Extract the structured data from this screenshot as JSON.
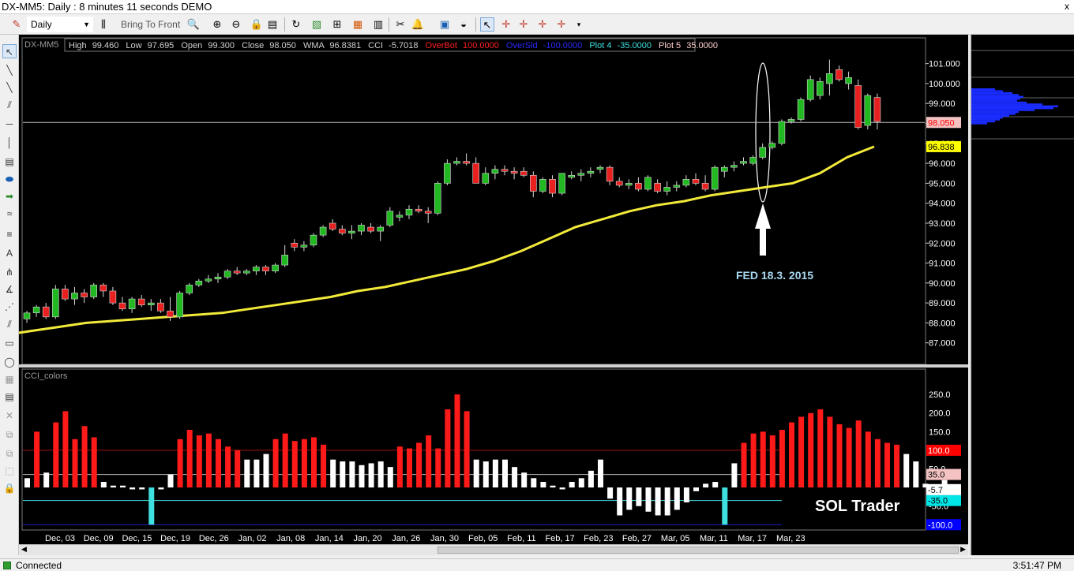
{
  "window": {
    "title": "DX-MM5: Daily : 8 minutes 11 seconds DEMO",
    "close_glyph": "x"
  },
  "toolbar": {
    "period": "Daily",
    "bring_to_front": "Bring To Front"
  },
  "chart_data": [
    {
      "type": "candlestick",
      "symbol": "DX-MM5",
      "info_bar": {
        "high_label": "High",
        "high": "99.460",
        "low_label": "Low",
        "low": "97.695",
        "open_label": "Open",
        "open": "99.300",
        "close_label": "Close",
        "close": "98.050",
        "wma_label": "WMA",
        "wma": "96.8381",
        "cci_label": "CCI",
        "cci": "-5.7018",
        "overbot_label": "OverBot",
        "overbot": "100.0000",
        "oversld_label": "OverSld",
        "oversld": "-100.0000",
        "plot4_label": "Plot 4",
        "plot4": "-35.0000",
        "plot5_label": "Plot 5",
        "plot5": "35.0000"
      },
      "y_ticks": [
        "101.000",
        "100.000",
        "99.000",
        "98.000",
        "97.000",
        "96.000",
        "95.000",
        "94.000",
        "93.000",
        "92.000",
        "91.000",
        "90.000",
        "89.000",
        "88.000",
        "87.000"
      ],
      "ylim": [
        86.0,
        101.5
      ],
      "last_price": "98.050",
      "wma_last": "96.838",
      "annotation": "FED 18.3. 2015",
      "candles": [
        {
          "o": 88.2,
          "h": 88.6,
          "l": 88.0,
          "c": 88.5
        },
        {
          "o": 88.5,
          "h": 88.9,
          "l": 88.3,
          "c": 88.8
        },
        {
          "o": 88.8,
          "h": 89.0,
          "l": 88.2,
          "c": 88.3
        },
        {
          "o": 88.3,
          "h": 89.9,
          "l": 88.2,
          "c": 89.7
        },
        {
          "o": 89.7,
          "h": 89.9,
          "l": 89.1,
          "c": 89.2
        },
        {
          "o": 89.2,
          "h": 89.8,
          "l": 88.9,
          "c": 89.5
        },
        {
          "o": 89.5,
          "h": 89.7,
          "l": 89.0,
          "c": 89.3
        },
        {
          "o": 89.3,
          "h": 90.0,
          "l": 89.2,
          "c": 89.9
        },
        {
          "o": 89.9,
          "h": 90.0,
          "l": 89.3,
          "c": 89.6
        },
        {
          "o": 89.6,
          "h": 89.8,
          "l": 88.9,
          "c": 89.0
        },
        {
          "o": 89.0,
          "h": 89.3,
          "l": 88.6,
          "c": 88.7
        },
        {
          "o": 88.7,
          "h": 89.3,
          "l": 88.5,
          "c": 89.2
        },
        {
          "o": 89.2,
          "h": 89.4,
          "l": 88.8,
          "c": 88.9
        },
        {
          "o": 88.9,
          "h": 89.2,
          "l": 88.6,
          "c": 89.0
        },
        {
          "o": 89.0,
          "h": 89.2,
          "l": 88.5,
          "c": 88.6
        },
        {
          "o": 88.6,
          "h": 89.3,
          "l": 88.1,
          "c": 88.3
        },
        {
          "o": 88.3,
          "h": 89.6,
          "l": 88.2,
          "c": 89.5
        },
        {
          "o": 89.5,
          "h": 90.0,
          "l": 89.4,
          "c": 89.9
        },
        {
          "o": 89.9,
          "h": 90.2,
          "l": 89.8,
          "c": 90.1
        },
        {
          "o": 90.1,
          "h": 90.4,
          "l": 90.0,
          "c": 90.2
        },
        {
          "o": 90.2,
          "h": 90.5,
          "l": 90.0,
          "c": 90.3
        },
        {
          "o": 90.3,
          "h": 90.7,
          "l": 90.2,
          "c": 90.6
        },
        {
          "o": 90.6,
          "h": 90.8,
          "l": 90.4,
          "c": 90.5
        },
        {
          "o": 90.5,
          "h": 90.7,
          "l": 90.4,
          "c": 90.6
        },
        {
          "o": 90.6,
          "h": 90.9,
          "l": 90.4,
          "c": 90.8
        },
        {
          "o": 90.8,
          "h": 90.9,
          "l": 90.4,
          "c": 90.6
        },
        {
          "o": 90.6,
          "h": 91.0,
          "l": 90.5,
          "c": 90.9
        },
        {
          "o": 90.9,
          "h": 91.9,
          "l": 90.8,
          "c": 91.4
        },
        {
          "o": 92.0,
          "h": 92.2,
          "l": 91.6,
          "c": 91.8
        },
        {
          "o": 91.8,
          "h": 92.1,
          "l": 91.6,
          "c": 91.9
        },
        {
          "o": 91.9,
          "h": 92.5,
          "l": 91.8,
          "c": 92.4
        },
        {
          "o": 92.4,
          "h": 92.9,
          "l": 92.3,
          "c": 92.8
        },
        {
          "o": 93.0,
          "h": 93.2,
          "l": 92.6,
          "c": 92.7
        },
        {
          "o": 92.7,
          "h": 92.9,
          "l": 92.4,
          "c": 92.5
        },
        {
          "o": 92.5,
          "h": 92.9,
          "l": 92.2,
          "c": 92.6
        },
        {
          "o": 92.6,
          "h": 93.0,
          "l": 92.4,
          "c": 92.9
        },
        {
          "o": 92.8,
          "h": 93.0,
          "l": 92.5,
          "c": 92.6
        },
        {
          "o": 92.6,
          "h": 92.9,
          "l": 92.1,
          "c": 92.8
        },
        {
          "o": 92.9,
          "h": 93.8,
          "l": 92.8,
          "c": 93.6
        },
        {
          "o": 93.3,
          "h": 93.6,
          "l": 93.1,
          "c": 93.4
        },
        {
          "o": 93.4,
          "h": 93.9,
          "l": 93.2,
          "c": 93.7
        },
        {
          "o": 93.7,
          "h": 93.9,
          "l": 93.5,
          "c": 93.6
        },
        {
          "o": 93.6,
          "h": 93.8,
          "l": 93.0,
          "c": 93.5
        },
        {
          "o": 93.5,
          "h": 95.1,
          "l": 93.4,
          "c": 95.0
        },
        {
          "o": 95.0,
          "h": 96.2,
          "l": 94.9,
          "c": 96.0
        },
        {
          "o": 96.0,
          "h": 96.3,
          "l": 95.9,
          "c": 96.1
        },
        {
          "o": 96.1,
          "h": 96.5,
          "l": 95.9,
          "c": 96.0
        },
        {
          "o": 96.0,
          "h": 96.3,
          "l": 95.0,
          "c": 95.0
        },
        {
          "o": 95.0,
          "h": 95.8,
          "l": 94.9,
          "c": 95.5
        },
        {
          "o": 95.5,
          "h": 95.9,
          "l": 95.2,
          "c": 95.7
        },
        {
          "o": 95.7,
          "h": 95.9,
          "l": 95.4,
          "c": 95.6
        },
        {
          "o": 95.6,
          "h": 95.8,
          "l": 95.2,
          "c": 95.5
        },
        {
          "o": 95.6,
          "h": 95.8,
          "l": 95.3,
          "c": 95.4
        },
        {
          "o": 95.4,
          "h": 95.6,
          "l": 94.3,
          "c": 94.6
        },
        {
          "o": 94.6,
          "h": 95.3,
          "l": 94.5,
          "c": 95.2
        },
        {
          "o": 95.2,
          "h": 95.4,
          "l": 94.3,
          "c": 94.5
        },
        {
          "o": 94.5,
          "h": 95.5,
          "l": 94.4,
          "c": 95.5
        },
        {
          "o": 95.3,
          "h": 95.6,
          "l": 95.2,
          "c": 95.4
        },
        {
          "o": 95.4,
          "h": 95.7,
          "l": 95.1,
          "c": 95.5
        },
        {
          "o": 95.5,
          "h": 95.8,
          "l": 95.3,
          "c": 95.6
        },
        {
          "o": 95.7,
          "h": 95.9,
          "l": 95.5,
          "c": 95.8
        },
        {
          "o": 95.8,
          "h": 95.9,
          "l": 94.9,
          "c": 95.1
        },
        {
          "o": 95.1,
          "h": 95.3,
          "l": 94.8,
          "c": 94.9
        },
        {
          "o": 94.9,
          "h": 95.2,
          "l": 94.7,
          "c": 95.0
        },
        {
          "o": 95.0,
          "h": 95.3,
          "l": 94.6,
          "c": 94.7
        },
        {
          "o": 94.7,
          "h": 95.4,
          "l": 94.6,
          "c": 95.3
        },
        {
          "o": 95.0,
          "h": 95.2,
          "l": 94.5,
          "c": 94.6
        },
        {
          "o": 94.6,
          "h": 95.1,
          "l": 94.4,
          "c": 94.8
        },
        {
          "o": 94.8,
          "h": 95.1,
          "l": 94.6,
          "c": 94.9
        },
        {
          "o": 94.9,
          "h": 95.4,
          "l": 94.8,
          "c": 95.2
        },
        {
          "o": 95.2,
          "h": 95.5,
          "l": 94.9,
          "c": 95.0
        },
        {
          "o": 95.0,
          "h": 95.4,
          "l": 94.6,
          "c": 94.7
        },
        {
          "o": 94.7,
          "h": 95.9,
          "l": 94.6,
          "c": 95.8
        },
        {
          "o": 95.6,
          "h": 95.9,
          "l": 95.3,
          "c": 95.8
        },
        {
          "o": 95.8,
          "h": 96.1,
          "l": 95.6,
          "c": 95.9
        },
        {
          "o": 96.0,
          "h": 96.3,
          "l": 95.9,
          "c": 96.1
        },
        {
          "o": 96.0,
          "h": 96.4,
          "l": 95.9,
          "c": 96.3
        },
        {
          "o": 96.3,
          "h": 97.0,
          "l": 96.2,
          "c": 96.8
        },
        {
          "o": 96.8,
          "h": 97.1,
          "l": 96.7,
          "c": 97.0
        },
        {
          "o": 97.0,
          "h": 98.2,
          "l": 96.9,
          "c": 98.1
        },
        {
          "o": 98.1,
          "h": 98.3,
          "l": 98.0,
          "c": 98.2
        },
        {
          "o": 98.2,
          "h": 99.3,
          "l": 98.1,
          "c": 99.2
        },
        {
          "o": 99.2,
          "h": 100.4,
          "l": 99.1,
          "c": 100.2
        },
        {
          "o": 99.4,
          "h": 100.3,
          "l": 99.2,
          "c": 100.1
        },
        {
          "o": 100.0,
          "h": 101.2,
          "l": 99.4,
          "c": 100.5
        },
        {
          "o": 100.7,
          "h": 100.9,
          "l": 100.1,
          "c": 100.2
        },
        {
          "o": 100.0,
          "h": 100.6,
          "l": 99.7,
          "c": 100.3
        },
        {
          "o": 99.9,
          "h": 100.2,
          "l": 97.7,
          "c": 97.8
        },
        {
          "o": 97.9,
          "h": 99.5,
          "l": 97.7,
          "c": 99.4
        },
        {
          "o": 99.3,
          "h": 99.5,
          "l": 97.7,
          "c": 98.1
        }
      ],
      "wma": [
        87.4,
        87.6,
        87.8,
        88.0,
        88.1,
        88.2,
        88.3,
        88.4,
        88.5,
        88.7,
        88.9,
        89.1,
        89.3,
        89.6,
        89.8,
        90.1,
        90.4,
        90.7,
        91.1,
        91.6,
        92.2,
        92.8,
        93.2,
        93.6,
        93.9,
        94.1,
        94.4,
        94.6,
        94.8,
        95.0,
        95.5,
        96.3,
        96.838
      ],
      "x_tick_labels": [
        "Dec, 03",
        "Dec, 09",
        "Dec, 15",
        "Dec, 19",
        "Dec, 26",
        "Jan, 02",
        "Jan, 08",
        "Jan, 14",
        "Jan, 20",
        "Jan, 26",
        "Jan, 30",
        "Feb, 05",
        "Feb, 11",
        "Feb, 17",
        "Feb, 23",
        "Feb, 27",
        "Mar, 05",
        "Mar, 11",
        "Mar, 17",
        "Mar, 23"
      ]
    },
    {
      "type": "bar",
      "title": "CCI_colors",
      "ylim": [
        -100,
        280
      ],
      "y_ticks": [
        "250.0",
        "200.0",
        "150.0",
        "100.0",
        "50.0",
        "-35.0",
        "-50.0"
      ],
      "levels": {
        "overbot": "100.0",
        "plot5": "35.0",
        "current": "-5.7",
        "plot4": "-35.0",
        "oversld": "-100.0"
      },
      "values": [
        25,
        150,
        40,
        175,
        205,
        130,
        165,
        135,
        15,
        5,
        5,
        -5,
        -5,
        -100,
        -5,
        35,
        130,
        155,
        140,
        145,
        130,
        110,
        100,
        75,
        75,
        90,
        130,
        145,
        125,
        130,
        135,
        115,
        75,
        70,
        70,
        60,
        65,
        70,
        55,
        110,
        105,
        120,
        140,
        105,
        210,
        250,
        205,
        75,
        70,
        75,
        75,
        55,
        40,
        25,
        15,
        5,
        -5,
        15,
        25,
        45,
        75,
        -30,
        -75,
        -60,
        -50,
        -65,
        -75,
        -75,
        -60,
        -40,
        -10,
        10,
        15,
        -100,
        65,
        120,
        145,
        150,
        140,
        155,
        175,
        190,
        200,
        210,
        190,
        170,
        160,
        180,
        150,
        130,
        120,
        115,
        90,
        70,
        10,
        -25,
        20,
        -5
      ],
      "text": "SOL Trader"
    }
  ],
  "status": {
    "connection": "Connected",
    "time": "3:51:47 PM"
  }
}
